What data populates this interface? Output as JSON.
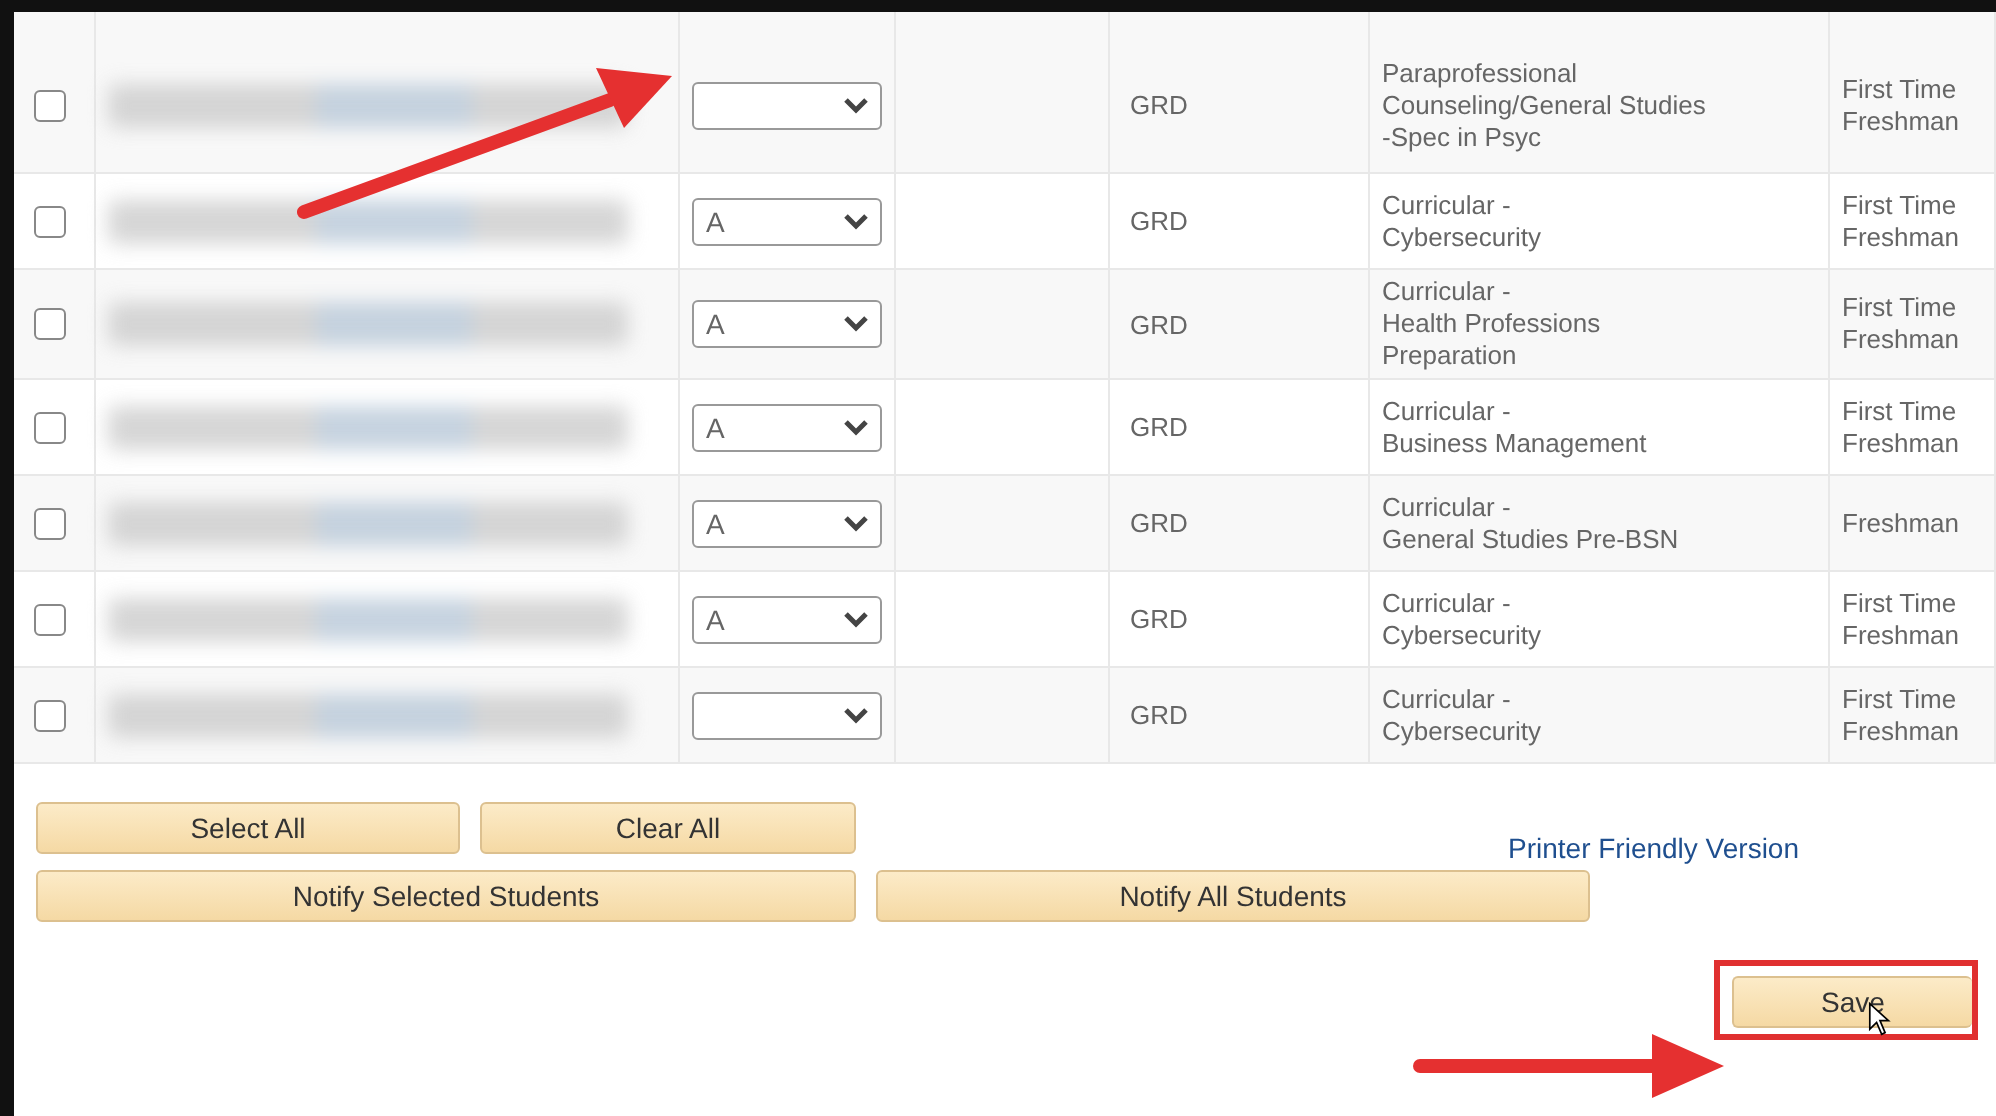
{
  "rows": [
    {
      "checked": false,
      "unit": "GRD",
      "program": [
        "Paraprofessional",
        "Counseling/General Studies",
        "-Spec in Psyc"
      ],
      "level": [
        "First Time",
        "Freshman"
      ]
    },
    {
      "checked": false,
      "grade": "A",
      "unit": "GRD",
      "program": [
        "Curricular -",
        "Cybersecurity"
      ],
      "level": [
        "First Time",
        "Freshman"
      ]
    },
    {
      "checked": false,
      "grade": "A",
      "unit": "GRD",
      "program": [
        "Curricular -",
        "Health Professions",
        "Preparation"
      ],
      "level": [
        "First Time",
        "Freshman"
      ]
    },
    {
      "checked": false,
      "grade": "A",
      "unit": "GRD",
      "program": [
        "Curricular -",
        "Business Management"
      ],
      "level": [
        "First Time",
        "Freshman"
      ]
    },
    {
      "checked": false,
      "grade": "A",
      "unit": "GRD",
      "program": [
        "Curricular -",
        "General Studies Pre-BSN"
      ],
      "level": [
        "Freshman"
      ]
    },
    {
      "checked": false,
      "grade": "A",
      "unit": "GRD",
      "program": [
        "Curricular -",
        "Cybersecurity"
      ],
      "level": [
        "First Time",
        "Freshman"
      ]
    },
    {
      "checked": false,
      "unit": "GRD",
      "program": [
        "Curricular -",
        "Cybersecurity"
      ],
      "level": [
        "First Time",
        "Freshman"
      ]
    }
  ],
  "buttons": {
    "select_all": "Select All",
    "clear_all": "Clear All",
    "notify_selected": "Notify Selected Students",
    "notify_all": "Notify All Students",
    "save": "Save"
  },
  "printer_link": "Printer Friendly Version"
}
